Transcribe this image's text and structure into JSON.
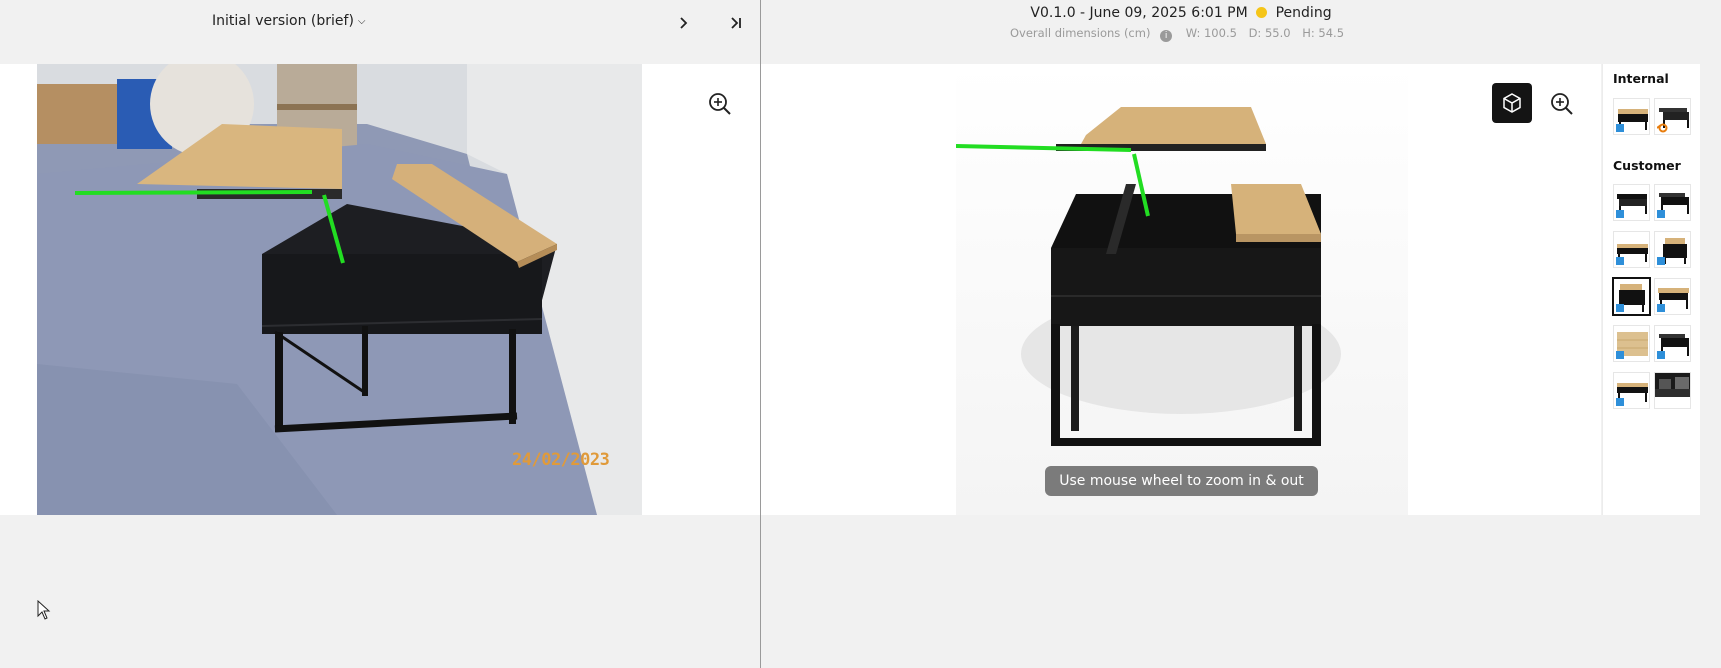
{
  "left": {
    "version_label": "Initial version (brief)",
    "next_icon": "chevron-right-icon",
    "last_icon": "skip-to-end-icon",
    "zoom_icon": "zoom-in-icon",
    "photo": {
      "description_icon": "reference-photo",
      "date_stamp": "24/02/2023"
    }
  },
  "right": {
    "version_text": "V0.1.0 - June 09, 2025 6:01 PM",
    "status": "Pending",
    "status_color": "#f5c518",
    "dims_label": "Overall dimensions (cm)",
    "width": "W: 100.5",
    "depth": "D: 55.0",
    "height": "H: 54.5",
    "cube_icon": "cube-3d-icon",
    "zoom_icon": "zoom-in-icon",
    "zoom_hint": "Use mouse wheel to zoom in & out"
  },
  "sidebar": {
    "internal_title": "Internal",
    "customer_title": "Customer"
  },
  "colors": {
    "annotation_line": "#22dd22",
    "wood": "#d6b27a",
    "metal": "#151515"
  }
}
